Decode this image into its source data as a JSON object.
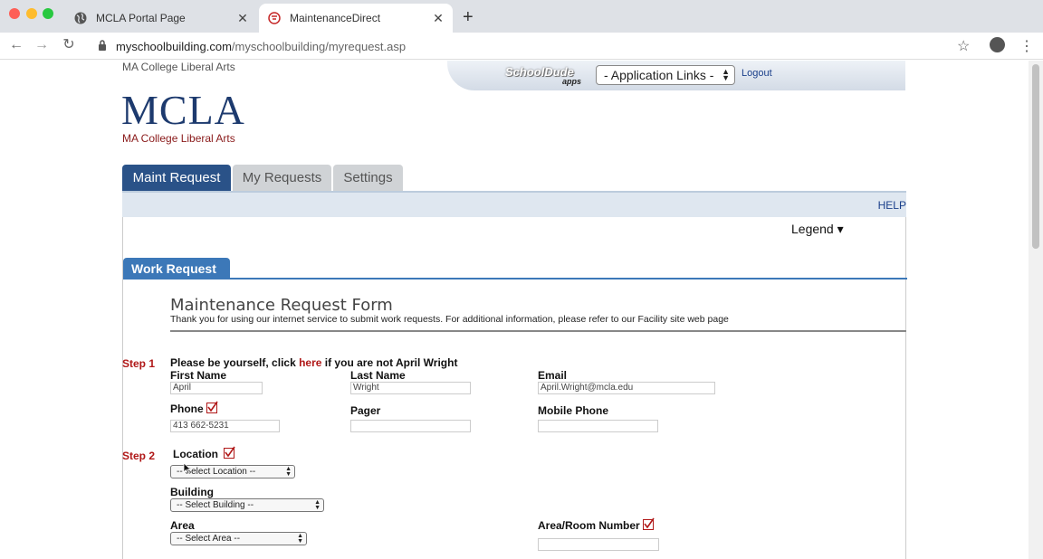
{
  "browser": {
    "tabs": [
      {
        "title": "MCLA Portal Page",
        "close": "✕"
      },
      {
        "title": "MaintenanceDirect",
        "close": "✕"
      }
    ],
    "new_tab": "+",
    "url_host": "myschoolbuilding.com",
    "url_path": "/myschoolbuilding/myrequest.asp"
  },
  "header": {
    "site_tag": "MA College Liberal Arts",
    "logo": "MCLA",
    "logo_sub": "MA College Liberal Arts",
    "apps_logo": "SchoolDude",
    "apps_logo_sub": "apps",
    "app_links": "- Application Links -",
    "logout": "Logout"
  },
  "main_tabs": [
    {
      "label": "Maint Request",
      "active": true
    },
    {
      "label": "My Requests",
      "active": false
    },
    {
      "label": "Settings",
      "active": false
    }
  ],
  "help": "HELP",
  "legend": "Legend ▾",
  "work_request_tab": "Work Request",
  "form": {
    "title": "Maintenance Request Form",
    "intro": "Thank you for using our internet service to submit work requests. For additional information, please refer to our Facility site web page",
    "step1_label": "Step 1",
    "step1_msg_pre": "Please be yourself, click ",
    "step1_msg_link": "here",
    "step1_msg_post": " if you are not April Wright",
    "first_name_label": "First Name",
    "first_name_value": "April",
    "last_name_label": "Last Name",
    "last_name_value": "Wright",
    "email_label": "Email",
    "email_value": "April.Wright@mcla.edu",
    "phone_label": "Phone",
    "phone_value": "413 662-5231",
    "pager_label": "Pager",
    "pager_value": "",
    "mobile_label": "Mobile Phone",
    "mobile_value": "",
    "step2_label": "Step 2",
    "location_label": "Location",
    "location_select": "-- Select Location --",
    "building_label": "Building",
    "building_select": "-- Select Building --",
    "area_label": "Area",
    "area_select": "-- Select Area --",
    "room_label": "Area/Room Number",
    "room_value": ""
  },
  "colors": {
    "tab_active": "#2a5288",
    "required_red": "#b01818",
    "work_request_blue": "#3c78b8"
  }
}
